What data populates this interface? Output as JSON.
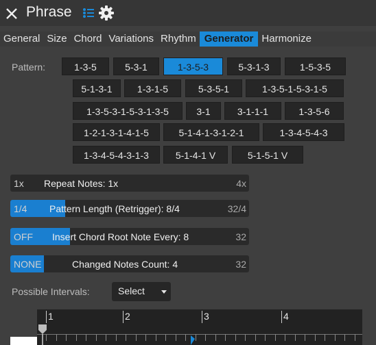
{
  "window": {
    "title": "Phrase"
  },
  "tabs": [
    "General",
    "Size",
    "Chord",
    "Variations",
    "Rhythm",
    "Generator",
    "Harmonize"
  ],
  "active_tab": "Generator",
  "pattern": {
    "label": "Pattern:",
    "selected": "1-3-5-3",
    "rows": [
      [
        "1-3-5",
        "5-3-1",
        "1-3-5-3",
        "5-3-1-3",
        "1-5-3-5"
      ],
      [
        "5-1-3-1",
        "1-3-1-5",
        "5-3-5-1",
        "1-3-5-1-5-3-1-5"
      ],
      [
        "1-3-5-3-1-5-3-1-3-5",
        "3-1",
        "3-1-1-1",
        "1-3-5-6"
      ],
      [
        "1-2-1-3-1-4-1-5",
        "5-1-4-1-3-1-2-1",
        "1-3-4-5-4-3"
      ],
      [
        "1-3-4-5-4-3-1-3",
        "5-1-4-1 V",
        "5-1-5-1 V"
      ]
    ]
  },
  "bars": [
    {
      "name": "repeat-notes",
      "min": "1x",
      "label": "Repeat Notes: 1x",
      "max": "4x",
      "fill_fraction": 0.0
    },
    {
      "name": "pattern-length",
      "min": "1/4",
      "label": "Pattern Length (Retrigger): 8/4",
      "max": "32/4",
      "fill_fraction": 0.23
    },
    {
      "name": "insert-chord-root",
      "min": "OFF",
      "label": "Insert Chord Root Note Every: 8",
      "max": "32",
      "fill_fraction": 0.25
    },
    {
      "name": "changed-notes-count",
      "min": "NONE",
      "label": "Changed Notes Count: 4",
      "max": "32",
      "fill_fraction": 0.14
    }
  ],
  "intervals": {
    "label": "Possible Intervals:",
    "select": "Select"
  },
  "timeline": {
    "markers": [
      "1",
      "2",
      "3",
      "4"
    ]
  },
  "colors": {
    "accent": "#1a8ad9",
    "background": "#3f3f3f",
    "button": "#262626"
  }
}
